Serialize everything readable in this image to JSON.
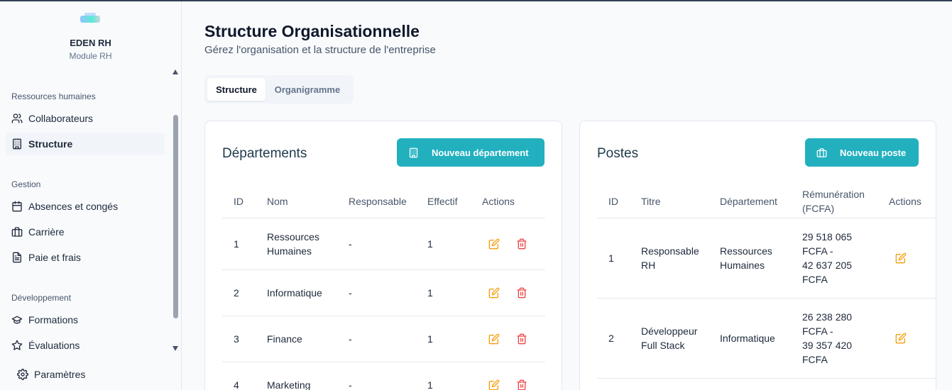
{
  "app": {
    "name": "EDEN RH",
    "subtitle": "Module RH",
    "logo_icon": "eden-logo-icon"
  },
  "sidebar": {
    "sections": [
      {
        "title": "Ressources humaines",
        "items": [
          {
            "label": "Collaborateurs",
            "icon": "users-icon",
            "active": false
          },
          {
            "label": "Structure",
            "icon": "building-icon",
            "active": true
          }
        ]
      },
      {
        "title": "Gestion",
        "items": [
          {
            "label": "Absences et congés",
            "icon": "calendar-icon",
            "active": false
          },
          {
            "label": "Carrière",
            "icon": "briefcase-icon",
            "active": false
          },
          {
            "label": "Paie et frais",
            "icon": "file-icon",
            "active": false
          }
        ]
      },
      {
        "title": "Développement",
        "items": [
          {
            "label": "Formations",
            "icon": "graduation-cap-icon",
            "active": false
          },
          {
            "label": "Évaluations",
            "icon": "star-icon",
            "active": false
          }
        ]
      }
    ],
    "settings_label": "Paramètres"
  },
  "page": {
    "title": "Structure Organisationnelle",
    "subtitle": "Gérez l'organisation et la structure de l'entreprise"
  },
  "tabs": [
    {
      "label": "Structure",
      "active": true
    },
    {
      "label": "Organigramme",
      "active": false
    }
  ],
  "departments": {
    "title": "Départements",
    "new_button": "Nouveau département",
    "columns": [
      "ID",
      "Nom",
      "Responsable",
      "Effectif",
      "Actions"
    ],
    "rows": [
      {
        "id": "1",
        "nom_line1": "Ressources",
        "nom_line2": "Humaines",
        "responsable": "-",
        "effectif": "1"
      },
      {
        "id": "2",
        "nom_line1": "Informatique",
        "nom_line2": "",
        "responsable": "-",
        "effectif": "1"
      },
      {
        "id": "3",
        "nom_line1": "Finance",
        "nom_line2": "",
        "responsable": "-",
        "effectif": "1"
      },
      {
        "id": "4",
        "nom_line1": "Marketing",
        "nom_line2": "",
        "responsable": "-",
        "effectif": "1"
      }
    ]
  },
  "postes": {
    "title": "Postes",
    "new_button": "Nouveau poste",
    "columns": [
      "ID",
      "Titre",
      "Département",
      "Rémunération",
      "(FCFA)",
      "Actions"
    ],
    "rows": [
      {
        "id": "1",
        "titre": [
          "Responsable",
          "RH"
        ],
        "departement": [
          "Ressources",
          "Humaines"
        ],
        "remuneration": [
          "29 518 065",
          "FCFA -",
          "42 637 205",
          "FCFA"
        ]
      },
      {
        "id": "2",
        "titre": [
          "Développeur",
          "Full Stack"
        ],
        "departement": [
          "Informatique",
          ""
        ],
        "remuneration": [
          "26 238 280",
          "FCFA -",
          "39 357 420",
          "FCFA"
        ]
      }
    ]
  },
  "colors": {
    "accent": "#22b0bf",
    "edit": "#f59e0b",
    "delete": "#ef4444"
  }
}
